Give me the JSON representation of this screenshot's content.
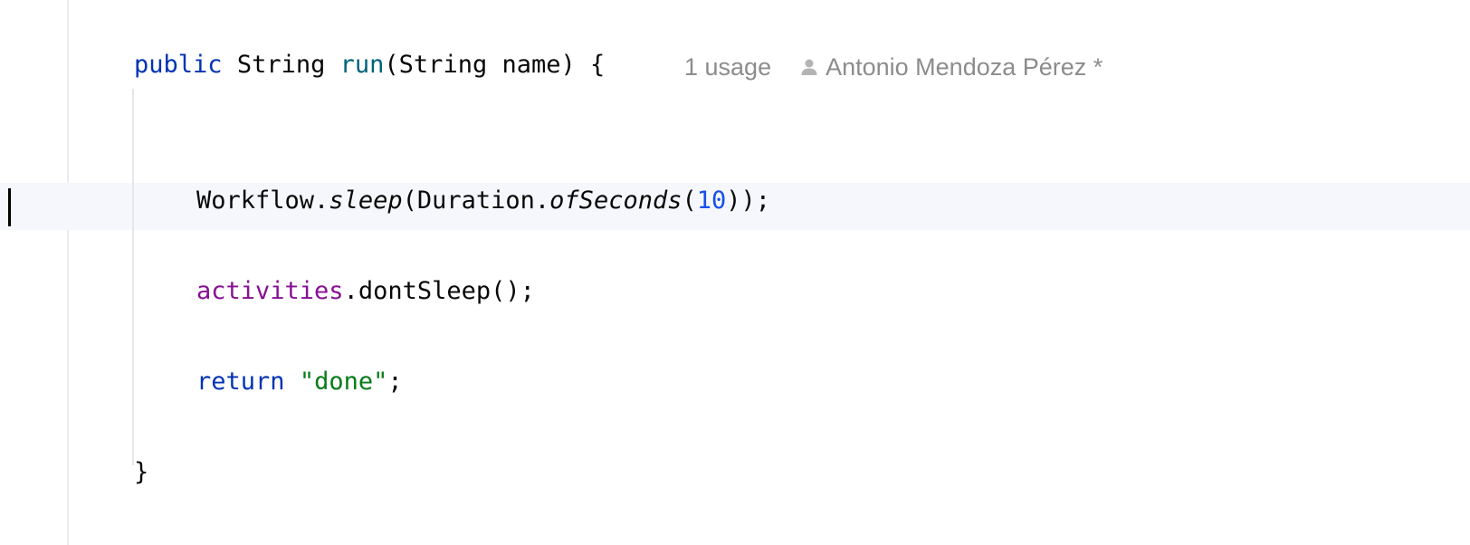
{
  "editor": {
    "line1": {
      "kw_public": "public",
      "sp1": " ",
      "type_string": "String",
      "sp2": " ",
      "method_name": "run",
      "paren_open": "(",
      "param_type": "String",
      "sp3": " ",
      "param_name": "name",
      "paren_close": ")",
      "sp4": " ",
      "brace_open": "{"
    },
    "hints": {
      "usages": "1 usage",
      "author_icon": "person-icon",
      "author": "Antonio Mendoza Pérez *"
    },
    "line2": {
      "class_workflow": "Workflow",
      "dot1": ".",
      "method_sleep": "sleep",
      "paren_open": "(",
      "class_duration": "Duration",
      "dot2": ".",
      "method_ofseconds": "ofSeconds",
      "paren_open2": "(",
      "number": "10",
      "tail": "));"
    },
    "line3": {
      "field_activities": "activities",
      "call": ".dontSleep();"
    },
    "line4": {
      "kw_return": "return",
      "sp": " ",
      "string_literal": "\"done\"",
      "semicolon": ";"
    },
    "line5": {
      "brace_close": "}"
    }
  },
  "colors": {
    "keyword": "#0033b3",
    "method_declaration": "#00627a",
    "field": "#871094",
    "number": "#1750eb",
    "string": "#067d17",
    "default_text": "#080808",
    "inlay_hint": "#8c8c8c",
    "current_line_background": "#f5f7fc"
  }
}
